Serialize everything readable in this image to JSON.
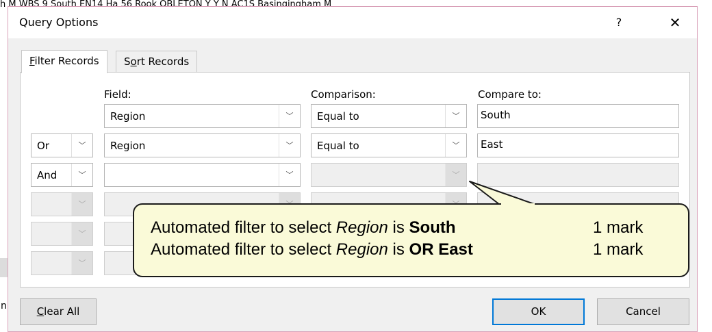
{
  "background": {
    "top_row_text": "h          M     WBS 9     South    EN14     Ha     56 Rook    OBLETON    Y     Y        N         AC1S        Basingingham     M",
    "left_fragment": "n"
  },
  "dialog": {
    "title": "Query Options",
    "help_label": "?",
    "close_label": "✕",
    "tabs": [
      {
        "pre": "",
        "accel": "F",
        "post": "ilter Records"
      },
      {
        "pre": "S",
        "accel": "o",
        "post": "rt Records"
      }
    ],
    "headers": {
      "field": "Field:",
      "comparison": "Comparison:",
      "compare_to": "Compare to:"
    },
    "rows": [
      {
        "logic": "",
        "field": "Region",
        "comparison": "Equal to",
        "compare_to": "South"
      },
      {
        "logic": "Or",
        "field": "Region",
        "comparison": "Equal to",
        "compare_to": "East"
      },
      {
        "logic": "And",
        "field": "",
        "comparison": "",
        "compare_to": ""
      },
      {
        "logic": "",
        "field": "",
        "comparison": "",
        "compare_to": ""
      },
      {
        "logic": "",
        "field": "",
        "comparison": "",
        "compare_to": ""
      },
      {
        "logic": "",
        "field": "",
        "comparison": "",
        "compare_to": ""
      }
    ],
    "buttons": {
      "clear_all": {
        "accel": "C",
        "post": "lear All"
      },
      "ok": "OK",
      "cancel": "Cancel"
    },
    "dropdown_arrow": "chevron-down"
  },
  "callout": {
    "lines": [
      {
        "pre": "Automated filter to select ",
        "italic": "Region",
        "mid": " is ",
        "bold": "South",
        "mark": "1 mark"
      },
      {
        "pre": "Automated filter to select ",
        "italic": "Region",
        "mid": " is ",
        "bold": "OR East",
        "mark": "1 mark"
      }
    ]
  }
}
